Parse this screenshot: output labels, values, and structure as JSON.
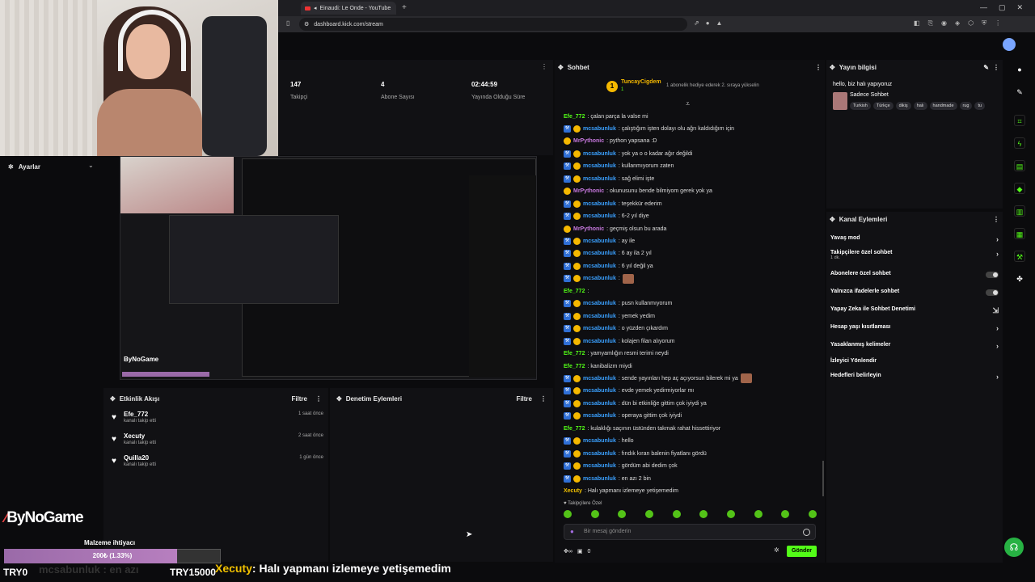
{
  "browser": {
    "tab_title": "Einaudi: Le Onde - YouTube",
    "url": "dashboard.kick.com/stream",
    "new_tab": "+",
    "window_controls": [
      "—",
      "▢",
      "✕"
    ]
  },
  "stats": [
    {
      "value": "147",
      "label": "Takipçi"
    },
    {
      "value": "4",
      "label": "Abone Sayısı"
    },
    {
      "value": "02:44:59",
      "label": "Yayında Olduğu Süre"
    }
  ],
  "settings": {
    "title": "Ayarlar"
  },
  "overlay": {
    "logo_part1": "By",
    "logo_part2": "NoGame",
    "goal_title": "Malzeme ihtiyacı",
    "goal_text": "200₺ (1.33%)",
    "goal_progress": 0.0133,
    "goal_min": "TRY0",
    "goal_max": "TRY15000",
    "ticker_user": "Xecuty",
    "ticker_text": ": Halı yapmanı izlemeye yetişemedim",
    "ghost_text": "mcsabunluk : en azı"
  },
  "activity": {
    "title": "Etkinlik Akışı",
    "filter": "Filtre",
    "items": [
      {
        "name": "Efe_772",
        "action": "kanalı takip etti",
        "time": "1 saat önce"
      },
      {
        "name": "Xecuty",
        "action": "kanalı takip etti",
        "time": "2 saat önce"
      },
      {
        "name": "Quilla20",
        "action": "kanalı takip etti",
        "time": "1 gün önce"
      }
    ]
  },
  "moderation": {
    "title": "Denetim Eylemleri",
    "filter": "Filtre"
  },
  "chat": {
    "title": "Sohbet",
    "pinned_user": "TuncayCigdem",
    "pinned_count": "1",
    "pinned_text": "1 abonelik hediye ederek 2. sıraya yükselin",
    "messages": [
      {
        "user": "Efe_772",
        "text": ": çalan parça la valse mi",
        "color": "#53fc18",
        "badges": 0
      },
      {
        "user": "mcsabunluk",
        "text": ": çalıştığım işten dolayı olu ağrı kaldıdığım için",
        "color": "#3aa0ff",
        "badges": 2
      },
      {
        "user": "MrPythonic",
        "text": ": python yapsana :D",
        "color": "#c678dd",
        "badges": 1
      },
      {
        "user": "mcsabunluk",
        "text": ": yok ya o o kadar ağır değildi",
        "color": "#3aa0ff",
        "badges": 2
      },
      {
        "user": "mcsabunluk",
        "text": ": kullanmıyorum zaten",
        "color": "#3aa0ff",
        "badges": 2
      },
      {
        "user": "mcsabunluk",
        "text": ": sağ elimi işte",
        "color": "#3aa0ff",
        "badges": 2
      },
      {
        "user": "MrPythonic",
        "text": ": okunusunu bende bilmiyom gerek yok ya",
        "color": "#c678dd",
        "badges": 1
      },
      {
        "user": "mcsabunluk",
        "text": ": teşekkür ederim",
        "color": "#3aa0ff",
        "badges": 2
      },
      {
        "user": "mcsabunluk",
        "text": ": 6-2 yıl diye",
        "color": "#3aa0ff",
        "badges": 2
      },
      {
        "user": "MrPythonic",
        "text": ": geçmiş olsun bu arada",
        "color": "#c678dd",
        "badges": 1
      },
      {
        "user": "mcsabunluk",
        "text": ": ay ile",
        "color": "#3aa0ff",
        "badges": 2
      },
      {
        "user": "mcsabunluk",
        "text": ": 6 ay ila 2 yıl",
        "color": "#3aa0ff",
        "badges": 2
      },
      {
        "user": "mcsabunluk",
        "text": ": 6 yıl değil ya",
        "color": "#3aa0ff",
        "badges": 2
      },
      {
        "user": "mcsabunluk",
        "text": ":",
        "color": "#3aa0ff",
        "badges": 2,
        "emote": true
      },
      {
        "user": "Efe_772",
        "text": ":",
        "color": "#53fc18",
        "badges": 0
      },
      {
        "user": "mcsabunluk",
        "text": ": pusn kullanmıyorum",
        "color": "#3aa0ff",
        "badges": 2
      },
      {
        "user": "mcsabunluk",
        "text": ": yemek yedim",
        "color": "#3aa0ff",
        "badges": 2
      },
      {
        "user": "mcsabunluk",
        "text": ": o yüzden çıkardım",
        "color": "#3aa0ff",
        "badges": 2
      },
      {
        "user": "mcsabunluk",
        "text": ": kolajen filan alıyorum",
        "color": "#3aa0ff",
        "badges": 2
      },
      {
        "user": "Efe_772",
        "text": ": yamyamlığın resmi terimi neydi",
        "color": "#53fc18",
        "badges": 0
      },
      {
        "user": "Efe_772",
        "text": ": kanibalizm miydi",
        "color": "#53fc18",
        "badges": 0
      },
      {
        "user": "mcsabunluk",
        "text": ": sende yayınları hep aç açıyorsun bilerek mi ya",
        "color": "#3aa0ff",
        "badges": 2,
        "emote": true
      },
      {
        "user": "mcsabunluk",
        "text": ": evde yemek yedirmiyorlar mı",
        "color": "#3aa0ff",
        "badges": 2
      },
      {
        "user": "mcsabunluk",
        "text": ": dün bi etkinliğe gittim çok iyiydi ya",
        "color": "#3aa0ff",
        "badges": 2
      },
      {
        "user": "mcsabunluk",
        "text": ": operaya gittim çok iyiydi",
        "color": "#3aa0ff",
        "badges": 2
      },
      {
        "user": "Efe_772",
        "text": ": kulaklığı saçının üstünden takmak rahat hissettiriyor",
        "color": "#53fc18",
        "badges": 0
      },
      {
        "user": "mcsabunluk",
        "text": ": hello",
        "color": "#3aa0ff",
        "badges": 2
      },
      {
        "user": "mcsabunluk",
        "text": ": fındık kıran balenin fiyatlanı gördü",
        "color": "#3aa0ff",
        "badges": 2
      },
      {
        "user": "mcsabunluk",
        "text": ": gördüm abi dedim çok",
        "color": "#3aa0ff",
        "badges": 2
      },
      {
        "user": "mcsabunluk",
        "text": ": en azı 2 bin",
        "color": "#3aa0ff",
        "badges": 2
      },
      {
        "user": "Xecuty",
        "text": ": Halı yapmanı izlemeye yetişemedim",
        "color": "#f0c000",
        "badges": 0
      }
    ],
    "followers_only": "Takipçilere Özel",
    "input_placeholder": "Bir mesaj gönderin",
    "count": "0",
    "send": "Gönder"
  },
  "stream_info": {
    "title": "Yayın bilgisi",
    "stream_title": "hello, biz halı yapıyoruz",
    "category": "Sadece Sohbet",
    "tags": [
      "Turkish",
      "Türkçe",
      "dikiş",
      "halı",
      "handmade",
      "rug",
      "tu"
    ]
  },
  "channel_actions": {
    "title": "Kanal Eylemleri",
    "items": [
      {
        "label": "Yavaş mod",
        "control": "arrow"
      },
      {
        "label": "Takipçilere özel sohbet",
        "sub": "1 dk.",
        "control": "arrow"
      },
      {
        "label": "Abonelere özel sohbet",
        "control": "toggle"
      },
      {
        "label": "Yalnızca ifadelerle sohbet",
        "control": "toggle"
      },
      {
        "label": "Yapay Zeka ile Sohbet Denetimi",
        "control": "link"
      },
      {
        "label": "Hesap yaşı kısıtlaması",
        "control": "arrow"
      },
      {
        "label": "Yasaklanmış kelimeler",
        "control": "arrow"
      },
      {
        "label": "İzleyici Yönlendir",
        "control": "none"
      },
      {
        "label": "Hedefleri belirleyin",
        "control": "arrow"
      }
    ]
  }
}
